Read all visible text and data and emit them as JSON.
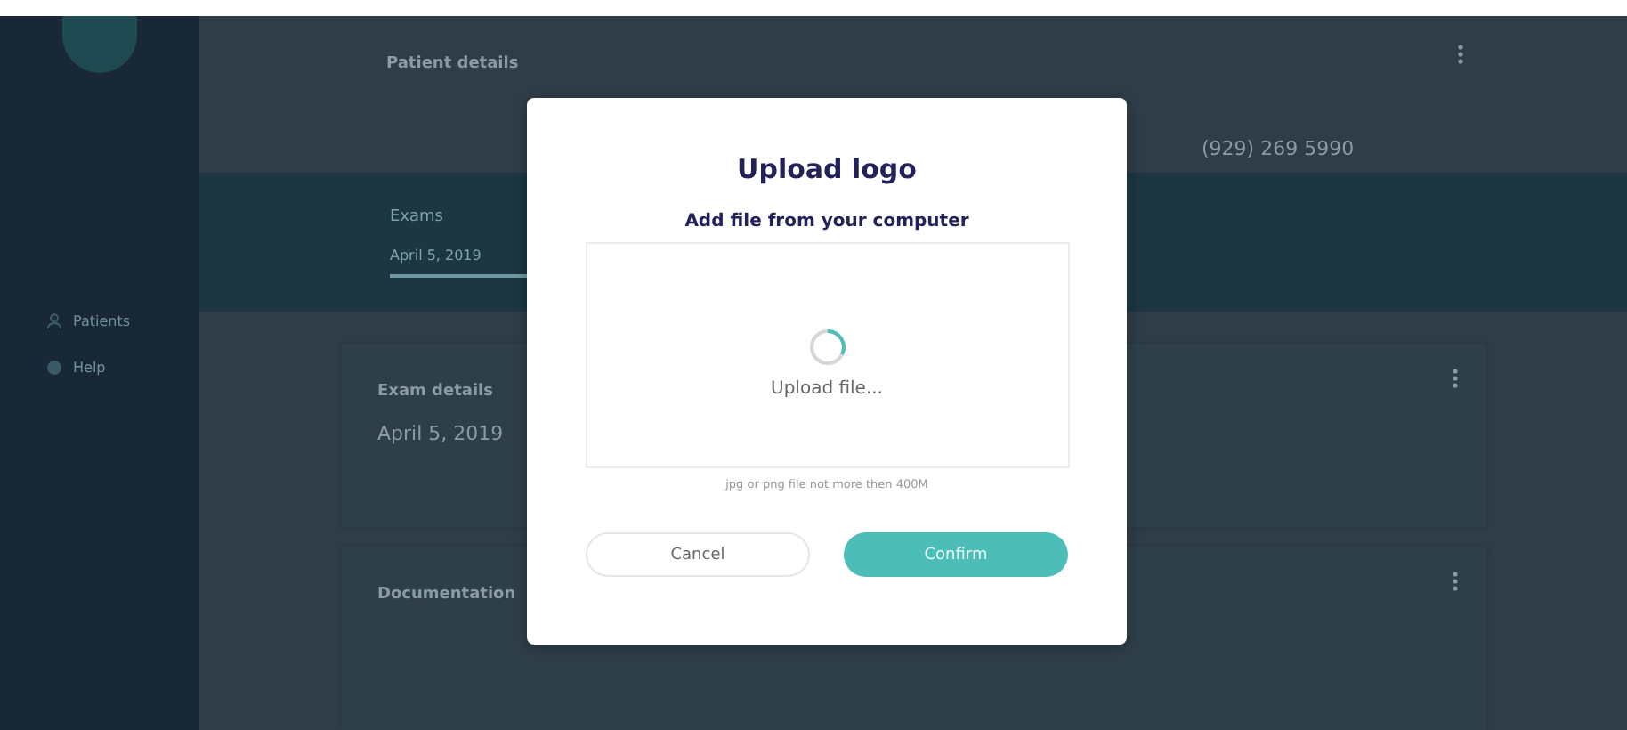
{
  "sidebar": {
    "items": [
      {
        "label": "Patients",
        "kind": "person"
      },
      {
        "label": "Help",
        "kind": "help"
      }
    ]
  },
  "patient_details": {
    "title": "Patient details",
    "phone": "(929) 269 5990"
  },
  "exams": {
    "title": "Exams",
    "items": [
      {
        "date": "April 5, 2019",
        "selected": true
      }
    ]
  },
  "cards": [
    {
      "title": "Exam details",
      "value": "April 5, 2019"
    },
    {
      "title": "Documentation"
    }
  ],
  "dialog": {
    "title": "Upload logo",
    "subtitle": "Add file from your computer",
    "status": "Upload file...",
    "hint": "jpg or png file not more then 400M",
    "buttons": [
      {
        "label": "Cancel",
        "kind": "secondary"
      },
      {
        "label": "Confirm",
        "kind": "primary"
      }
    ]
  }
}
